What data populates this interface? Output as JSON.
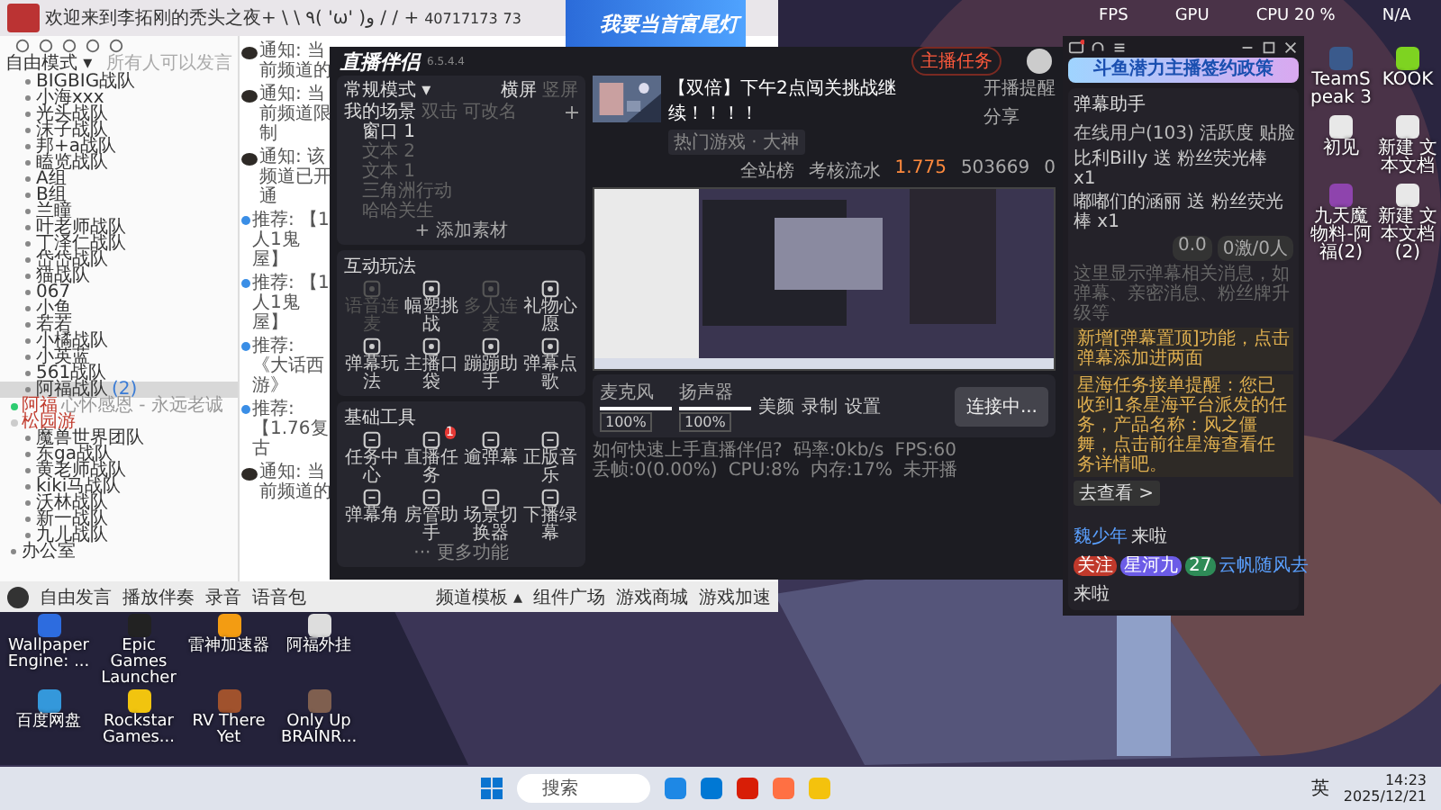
{
  "yy": {
    "title": "欢迎来到李拓刚的秃头之夜+ \\ \\ ٩( 'ω' )و / / +",
    "channel_id": "40717173",
    "online": "73",
    "mode": "自由模式 ▾",
    "mode_hint": "所有人可以发言",
    "channel_groups": [
      {
        "label": "BIGBIG战队",
        "selected": false
      },
      {
        "label": "小海xxx",
        "selected": false
      },
      {
        "label": "光头战队",
        "selected": false
      },
      {
        "label": "沫子战队",
        "selected": false
      },
      {
        "label": "邦+a战队",
        "selected": false
      },
      {
        "label": "瞌览战队",
        "selected": false
      },
      {
        "label": "A组",
        "selected": false
      },
      {
        "label": "B组",
        "selected": false
      },
      {
        "label": "兰瞳",
        "selected": false
      },
      {
        "label": "叶老师战队",
        "selected": false
      },
      {
        "label": "丁泽仁战队",
        "selected": false
      },
      {
        "label": "岱岱战队",
        "selected": false
      },
      {
        "label": "猫战队",
        "selected": false
      },
      {
        "label": "067",
        "selected": false
      },
      {
        "label": "小鱼",
        "selected": false
      },
      {
        "label": "若若",
        "selected": false
      },
      {
        "label": "小橘战队",
        "selected": false
      },
      {
        "label": "小英蓝",
        "selected": false
      },
      {
        "label": "561战队",
        "selected": false
      },
      {
        "label": "阿福战队",
        "count": "(2)",
        "selected": true,
        "children": [
          {
            "name": "阿福",
            "status": "心怀感恩 - 永远老诚",
            "speaking": true
          },
          {
            "name": "松园游",
            "speaking": false
          }
        ]
      },
      {
        "label": "魔兽世界团队",
        "selected": false
      },
      {
        "label": "东ga战队",
        "selected": false
      },
      {
        "label": "黄老师战队",
        "selected": false
      },
      {
        "label": "kiki马战队",
        "selected": false
      },
      {
        "label": "沃林战队",
        "selected": false
      },
      {
        "label": "新一战队",
        "selected": false
      },
      {
        "label": "九儿战队",
        "selected": false
      }
    ],
    "root_channel": "办公室",
    "messages": [
      {
        "kind": "notice",
        "label": "通知:",
        "text": "当前频道的"
      },
      {
        "kind": "notice",
        "label": "通知:",
        "text": "当前频道限制"
      },
      {
        "kind": "notice",
        "label": "通知:",
        "text": "该频道已开通"
      },
      {
        "kind": "recommend",
        "label": "推荐:",
        "text": "【1人1鬼屋】"
      },
      {
        "kind": "recommend",
        "label": "推荐:",
        "text": "【1人1鬼屋】"
      },
      {
        "kind": "recommend",
        "label": "推荐:",
        "text": "《大话西游》"
      },
      {
        "kind": "recommend",
        "label": "推荐:",
        "text": "【1.76复古"
      },
      {
        "kind": "notice",
        "label": "通知:",
        "text": "当前频道的"
      }
    ],
    "toolbar": [
      "自由发言",
      "播放伴奏",
      "录音",
      "语音包"
    ],
    "toolbar_right": [
      "频道模板 ▴",
      "组件广场",
      "游戏商城",
      "游戏加速"
    ]
  },
  "live": {
    "app_name": "直播伴侣",
    "version": "6.5.4.4",
    "banner": "我要当首富尾灯",
    "task_button": "主播任务",
    "mode": "常规模式 ▾",
    "orientations": [
      {
        "label": "横屏",
        "selected": true
      },
      {
        "label": "竖屏",
        "selected": false
      }
    ],
    "scenes_title": "我的场景",
    "scenes_hint": [
      "双击",
      "可改名"
    ],
    "scenes": [
      {
        "label": "窗口 1",
        "visible": true
      },
      {
        "label": "文本 2",
        "visible": false
      },
      {
        "label": "文本 1",
        "visible": false
      },
      {
        "label": "三角洲行动",
        "visible": false
      },
      {
        "label": "哈哈关生",
        "visible": false
      }
    ],
    "add_material": "+ 添加素材",
    "interact_title": "互动玩法",
    "interact": [
      {
        "label": "语音连麦",
        "disabled": true
      },
      {
        "label": "幅塑挑战",
        "disabled": false
      },
      {
        "label": "多人连麦",
        "disabled": true
      },
      {
        "label": "礼物心愿",
        "disabled": false
      },
      {
        "label": "弹幕玩法",
        "disabled": false
      },
      {
        "label": "主播口袋",
        "disabled": false
      },
      {
        "label": "蹦蹦助手",
        "disabled": false
      },
      {
        "label": "弹幕点歌",
        "disabled": false
      }
    ],
    "tools_title": "基础工具",
    "tools": [
      {
        "label": "任务中心"
      },
      {
        "label": "直播任务",
        "badge": "1"
      },
      {
        "label": "逾弹幕"
      },
      {
        "label": "正版音乐"
      },
      {
        "label": "弹幕角"
      },
      {
        "label": "房管助手"
      },
      {
        "label": "场景切换器"
      },
      {
        "label": "下播绿幕"
      }
    ],
    "more": "··· 更多功能",
    "stream_title": "【双倍】下午2点闯关挑战继续！！！！",
    "category": "热门游戏 · 大神",
    "remind": "开播提醒",
    "share": "分享",
    "rank": "全站榜",
    "flow_label": "考核流水",
    "flow_value": "1.775",
    "heat": "503669",
    "likes": "0",
    "controls": [
      {
        "kind": "slider",
        "label": "麦克风",
        "level": 1,
        "reading": "100%"
      },
      {
        "kind": "slider",
        "label": "扬声器",
        "level": 1,
        "reading": "100%"
      },
      {
        "kind": "button",
        "label": "美颜"
      },
      {
        "kind": "button",
        "label": "录制"
      },
      {
        "kind": "button",
        "label": "设置"
      }
    ],
    "connect": "连接中...",
    "help": "如何快速上手直播伴侣?",
    "stats": [
      "码率:0kb/s",
      "FPS:60",
      "丢帧:0(0.00%)",
      "CPU:8%",
      "内存:17%",
      "未开播"
    ]
  },
  "danmu": {
    "banner": "斗鱼潜力主播签约政策",
    "title": "弹幕助手",
    "tabs": [
      {
        "label": "在线用户(103)",
        "selected": false
      },
      {
        "label": "活跃度",
        "selected": false
      },
      {
        "label": "贴脸",
        "selected": false
      }
    ],
    "gifts": [
      {
        "user": "比利Billy",
        "verb": "送",
        "gift": "粉丝荧光棒",
        "count": "x1"
      },
      {
        "user": "嘟嘟们的涵丽",
        "verb": "送",
        "gift": "粉丝荧光棒",
        "count": "x1"
      }
    ],
    "score": "0.0",
    "counter": "0激/0人",
    "hint": "这里显示弹幕相关消息，如弹幕、亲密消息、粉丝牌升级等",
    "notices": [
      "新增[弹幕置顶]功能，点击弹幕添加进两面",
      "星海任务接单提醒：您已收到1条星海平台派发的任务，产品名称：风之僵舞，点击前往星海查看任务详情吧。"
    ],
    "view": "去查看 >",
    "arrivals": [
      {
        "user": "魏少年",
        "text": "来啦"
      }
    ],
    "tags": [
      {
        "label": "关注",
        "color": "#c0392b"
      },
      {
        "label": "星河九",
        "color": "#6c5ce7"
      },
      {
        "label": "27",
        "color": "#2e8b57"
      }
    ],
    "last_user": "云帆随风去",
    "last_text": "来啦"
  },
  "desktop": {
    "monitor": [
      "FPS",
      "GPU",
      "CPU 20 %",
      "N/A"
    ],
    "right_icons": [
      {
        "label": "TeamSpeak 3",
        "color": "#3a5a8c"
      },
      {
        "label": "KOOK",
        "color": "#7ed321"
      },
      {
        "label": "初见",
        "color": "#e8e8e8"
      },
      {
        "label": "新建 文本文档",
        "color": "#e8e8e8"
      },
      {
        "label": "九天魔物料-阿福(2)",
        "color": "#8e44ad"
      },
      {
        "label": "新建 文本文档 (2)",
        "color": "#e8e8e8"
      }
    ],
    "left_icons": [
      {
        "label": "Wallpaper Engine: ...",
        "color": "#2d6cdf"
      },
      {
        "label": "Epic Games Launcher",
        "color": "#222222"
      },
      {
        "label": "雷神加速器",
        "color": "#f39c12"
      },
      {
        "label": "阿福外挂",
        "color": "#dddddd"
      },
      {
        "label": "百度网盘",
        "color": "#3498db"
      },
      {
        "label": "Rockstar Games...",
        "color": "#f1c40f"
      },
      {
        "label": "RV There Yet",
        "color": "#a0522d"
      },
      {
        "label": "Only Up BRAINR...",
        "color": "#7f5f4f"
      }
    ]
  },
  "taskbar": {
    "search": "搜索",
    "apps": [
      {
        "color": "#1e88e5"
      },
      {
        "color": "#0078d4"
      },
      {
        "color": "#d81e06"
      },
      {
        "color": "#ff7043"
      },
      {
        "color": "#f4c20d"
      }
    ],
    "ime": "英",
    "time": "14:23",
    "date": "2025/12/21"
  }
}
